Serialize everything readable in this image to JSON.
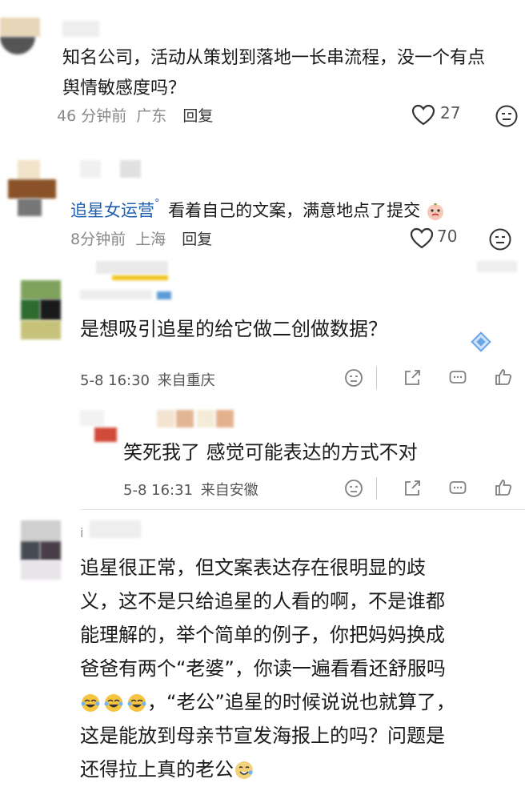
{
  "colors": {
    "accent": "#1e5fb0",
    "text": "#1a1a1a",
    "meta": "#888888"
  },
  "comment1": {
    "text_line1": "知名公司，活动从策划到落地一长串流程，没一个有点",
    "text_line2": "舆情敏感度吗？",
    "time": "46 分钟前",
    "location": "广东",
    "reply_label": "回复",
    "likes": "27",
    "like_icon": "heart-icon",
    "emoji_icon": "emoji-face-icon"
  },
  "comment2": {
    "username": "追星女运营",
    "text": "看着自己的文案，满意地点了提交",
    "time": "8分钟前",
    "location": "上海",
    "reply_label": "回复",
    "likes": "70"
  },
  "weibo1": {
    "text": "是想吸引追星的给它做二创做数据？",
    "time": "5-8 16:30",
    "source": "来自重庆"
  },
  "weibo_reply": {
    "text": "笑死我了 感觉可能表达的方式不对",
    "time": "5-8 16:31",
    "source": "来自安徽"
  },
  "weibo2": {
    "username_fragment": "i",
    "lines": [
      "追星很正常，但文案表达存在很明显的歧",
      "义，这不是只给追星的人看的啊，不是谁都",
      "能理解的，举个简单的例子，你把妈妈换成",
      "爸爸有两个“老婆”，你读一遍看看还舒服吗",
      "，“老公”追星的时候说说也就算了，",
      "这是能放到母亲节宣发海报上的吗？问题是",
      "还得拉上真的老公"
    ]
  }
}
